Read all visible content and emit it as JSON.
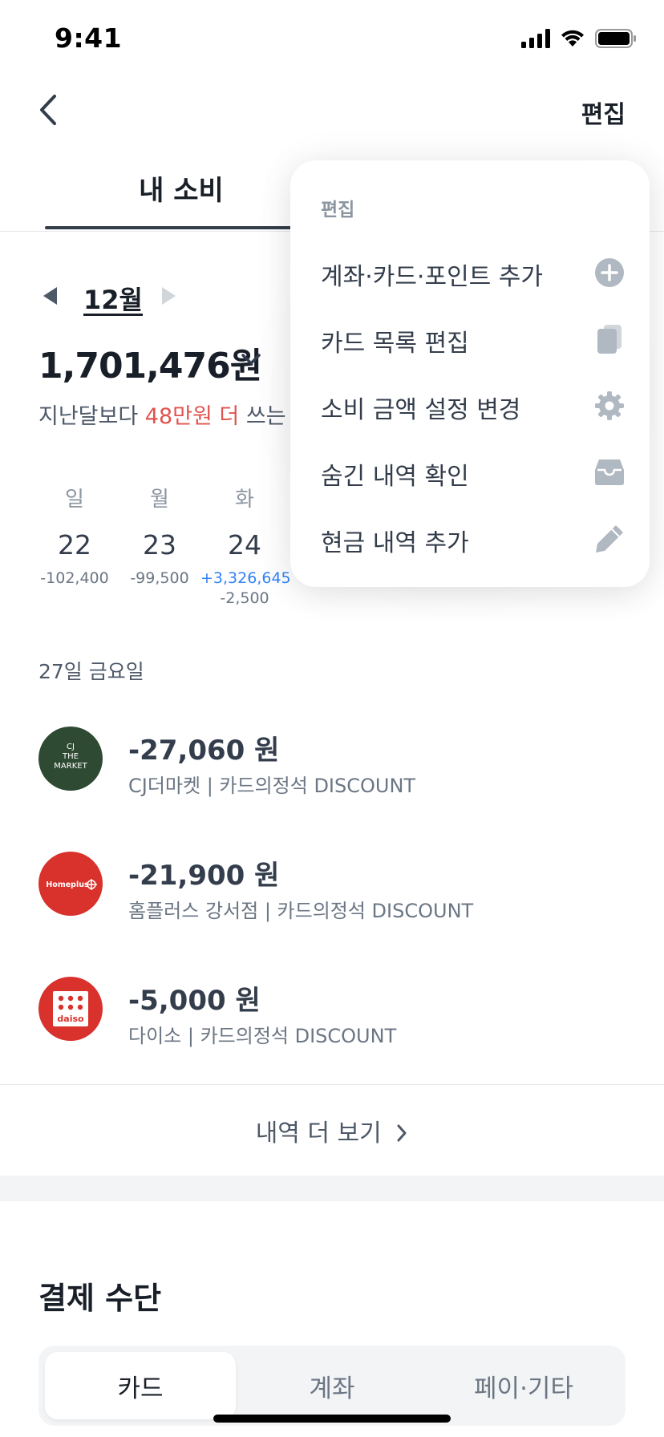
{
  "status_bar": {
    "time": "9:41"
  },
  "header": {
    "edit_label": "편집"
  },
  "tabs": {
    "active_label": "내 소비"
  },
  "month": {
    "label": "12월"
  },
  "summary": {
    "total": "1,701,476원",
    "compare_prefix": "지난달보다 ",
    "compare_highlight": "48만원 더",
    "compare_suffix": " 쓰는"
  },
  "calendar": [
    {
      "dow": "일",
      "date": "22",
      "amount": "-102,400",
      "income": ""
    },
    {
      "dow": "월",
      "date": "23",
      "amount": "-99,500",
      "income": ""
    },
    {
      "dow": "화",
      "date": "24",
      "income": "+3,326,645",
      "amount": "-2,500"
    }
  ],
  "day_label": "27일 금요일",
  "transactions": [
    {
      "amount": "-27,060 원",
      "desc": "CJ더마켓 | 카드의정석 DISCOUNT",
      "logo_text": [
        "CJ",
        "THE",
        "MARKET"
      ],
      "logo_color": "#2f4a33"
    },
    {
      "amount": "-21,900 원",
      "desc": "홈플러스 강서점 | 카드의정석 DISCOUNT",
      "logo_text": [
        "Homeplus"
      ],
      "logo_color": "#d9312b"
    },
    {
      "amount": "-5,000 원",
      "desc": "다이소 | 카드의정석 DISCOUNT",
      "logo_text": [
        "daiso"
      ],
      "logo_color": "#d9312b"
    }
  ],
  "more_label": "내역 더 보기",
  "payment": {
    "title": "결제 수단",
    "segments": [
      "카드",
      "계좌",
      "페이·기타"
    ]
  },
  "menu": {
    "heading": "편집",
    "items": [
      {
        "label": "계좌·카드·포인트 추가",
        "icon": "plus-circle-icon"
      },
      {
        "label": "카드 목록 편집",
        "icon": "cards-icon"
      },
      {
        "label": "소비 금액 설정 변경",
        "icon": "gear-icon"
      },
      {
        "label": "숨긴 내역 확인",
        "icon": "inbox-icon"
      },
      {
        "label": "현금 내역 추가",
        "icon": "pencil-icon"
      }
    ]
  }
}
